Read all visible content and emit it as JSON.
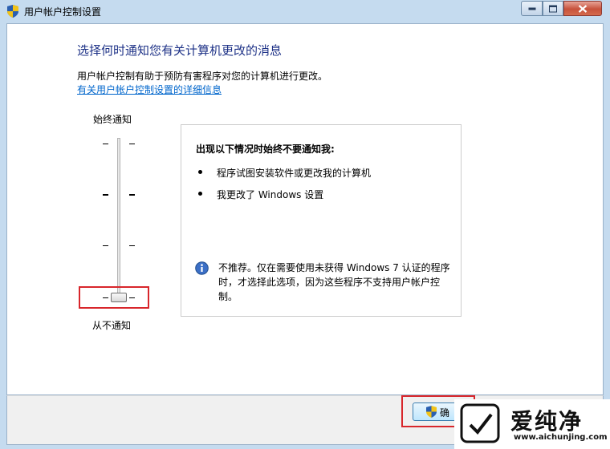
{
  "window": {
    "title": "用户帐户控制设置",
    "icon": "uac-shield-icon",
    "buttons": [
      "minimize-icon",
      "maximize-icon",
      "close-icon"
    ]
  },
  "main": {
    "heading": "选择何时通知您有关计算机更改的消息",
    "description": "用户帐户控制有助于预防有害程序对您的计算机进行更改。",
    "link": "有关用户帐户控制设置的详细信息"
  },
  "slider": {
    "top_label": "始终通知",
    "bottom_label": "从不通知",
    "levels": 4,
    "selected_level": 1
  },
  "info_panel": {
    "title": "出现以下情况时始终不要通知我:",
    "bullets": [
      "程序试图安装软件或更改我的计算机",
      "我更改了 Windows 设置"
    ],
    "note": "不推荐。仅在需要使用未获得 Windows 7 认证的程序时，才选择此选项，因为这些程序不支持用户帐户控制。"
  },
  "footer": {
    "ok_label": "确"
  },
  "watermark": {
    "brand": "爱纯净",
    "url": "www.aichunjing.com"
  },
  "colors": {
    "heading": "#1e3287",
    "link": "#0066cc",
    "highlight": "#d8262b",
    "title_bar": "#c5dbef"
  }
}
